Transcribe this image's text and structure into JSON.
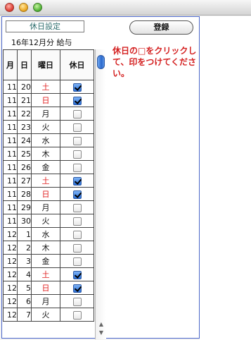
{
  "window": {
    "traffic_lights": [
      "close",
      "minimize",
      "maximize"
    ]
  },
  "header": {
    "title": "休日設定",
    "period": "16年12月分 給与",
    "register_label": "登録"
  },
  "instructions": "休日の□をクリックして、印をつけてください。",
  "table": {
    "columns": [
      "月",
      "日",
      "曜日",
      "休日"
    ],
    "rows": [
      {
        "month": "11",
        "day": "20",
        "dow": "土",
        "holiday": true,
        "red": true
      },
      {
        "month": "11",
        "day": "21",
        "dow": "日",
        "holiday": true,
        "red": true
      },
      {
        "month": "11",
        "day": "22",
        "dow": "月",
        "holiday": false,
        "red": false
      },
      {
        "month": "11",
        "day": "23",
        "dow": "火",
        "holiday": false,
        "red": false
      },
      {
        "month": "11",
        "day": "24",
        "dow": "水",
        "holiday": false,
        "red": false
      },
      {
        "month": "11",
        "day": "25",
        "dow": "木",
        "holiday": false,
        "red": false
      },
      {
        "month": "11",
        "day": "26",
        "dow": "金",
        "holiday": false,
        "red": false
      },
      {
        "month": "11",
        "day": "27",
        "dow": "土",
        "holiday": true,
        "red": true
      },
      {
        "month": "11",
        "day": "28",
        "dow": "日",
        "holiday": true,
        "red": true
      },
      {
        "month": "11",
        "day": "29",
        "dow": "月",
        "holiday": false,
        "red": false
      },
      {
        "month": "11",
        "day": "30",
        "dow": "火",
        "holiday": false,
        "red": false
      },
      {
        "month": "12",
        "day": "1",
        "dow": "水",
        "holiday": false,
        "red": false
      },
      {
        "month": "12",
        "day": "2",
        "dow": "木",
        "holiday": false,
        "red": false
      },
      {
        "month": "12",
        "day": "3",
        "dow": "金",
        "holiday": false,
        "red": false
      },
      {
        "month": "12",
        "day": "4",
        "dow": "土",
        "holiday": true,
        "red": true
      },
      {
        "month": "12",
        "day": "5",
        "dow": "日",
        "holiday": true,
        "red": true
      },
      {
        "month": "12",
        "day": "6",
        "dow": "月",
        "holiday": false,
        "red": false
      },
      {
        "month": "12",
        "day": "7",
        "dow": "火",
        "holiday": false,
        "red": false
      }
    ]
  },
  "colors": {
    "weekend": "#e02020",
    "instruction": "#d42020",
    "border": "#4a66c8"
  }
}
